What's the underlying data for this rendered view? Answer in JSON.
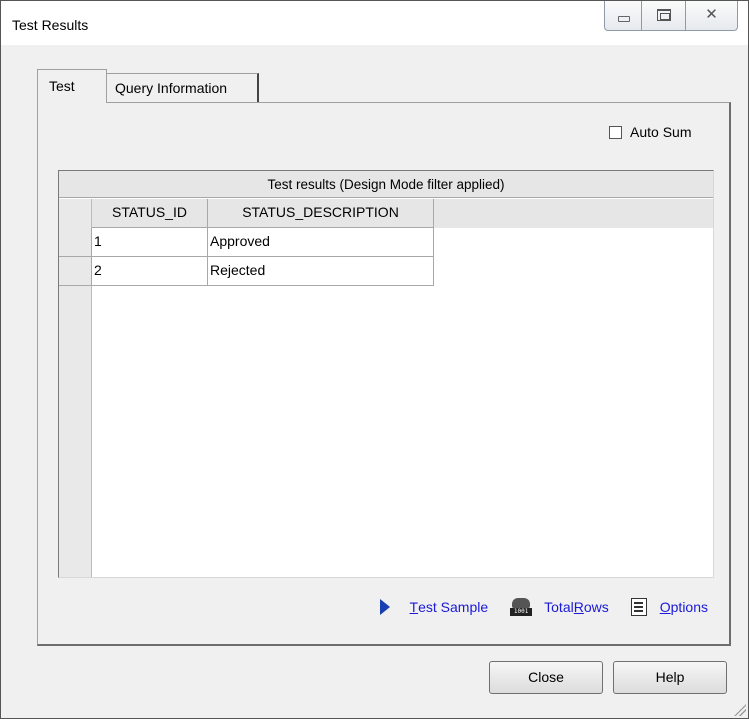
{
  "window": {
    "title": "Test Results"
  },
  "tabs": [
    {
      "label": "Test",
      "active": true
    },
    {
      "label": "Query Information",
      "active": false
    }
  ],
  "auto_sum": {
    "label": "Auto Sum",
    "checked": false
  },
  "grid": {
    "caption": "Test results (Design Mode filter applied)",
    "columns": [
      "STATUS_ID",
      "STATUS_DESCRIPTION"
    ],
    "rows": [
      [
        "1",
        "Approved"
      ],
      [
        "2",
        "Rejected"
      ]
    ]
  },
  "actions": {
    "test_sample": {
      "pre": "",
      "ul": "T",
      "post": "est Sample",
      "icon": "play-icon"
    },
    "total_rows": {
      "pre": "Total ",
      "ul": "R",
      "post": "ows",
      "icon": "database-icon"
    },
    "options": {
      "pre": "",
      "ul": "O",
      "post": "ptions",
      "icon": "list-icon"
    }
  },
  "footer": {
    "close_label": "Close",
    "help_label": "Help"
  },
  "colors": {
    "link": "#1a1ad8",
    "dialog_bg": "#f0f0f0"
  }
}
